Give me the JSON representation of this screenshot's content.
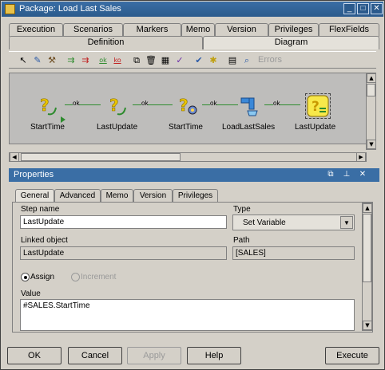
{
  "window": {
    "title": "Package: Load Last Sales"
  },
  "top_tabs": {
    "row1": [
      "Execution",
      "Scenarios",
      "Markers",
      "Memo",
      "Version",
      "Privileges",
      "FlexFields"
    ],
    "row2": [
      "Definition",
      "Diagram"
    ],
    "active": "Diagram"
  },
  "toolbar": {
    "errors_label": "Errors"
  },
  "diagram": {
    "nodes": [
      {
        "label": "StartTime",
        "icon": "variable-question-icon"
      },
      {
        "label": "LastUpdate",
        "icon": "variable-question-icon"
      },
      {
        "label": "StartTime",
        "icon": "variable-question-gear-icon"
      },
      {
        "label": "LoadLastSales",
        "icon": "interface-icon"
      },
      {
        "label": "LastUpdate",
        "icon": "variable-set-icon"
      }
    ],
    "link_label": "ok",
    "link_color": "#2e8b2e"
  },
  "properties": {
    "title": "Properties",
    "tabs": [
      "General",
      "Advanced",
      "Memo",
      "Version",
      "Privileges"
    ],
    "active_tab": "General",
    "step_name_label": "Step name",
    "step_name_value": "LastUpdate",
    "type_label": "Type",
    "type_value": "Set Variable",
    "linked_object_label": "Linked object",
    "linked_object_value": "LastUpdate",
    "path_label": "Path",
    "path_value": "[SALES]",
    "assign_label": "Assign",
    "increment_label": "Increment",
    "value_label": "Value",
    "value_text": "#SALES.StartTime"
  },
  "buttons": {
    "ok": "OK",
    "cancel": "Cancel",
    "apply": "Apply",
    "help": "Help",
    "execute": "Execute"
  },
  "colors": {
    "titlebar": "#3a6ea5",
    "canvas": "#bebdbb",
    "panel": "#d4d0c8"
  }
}
